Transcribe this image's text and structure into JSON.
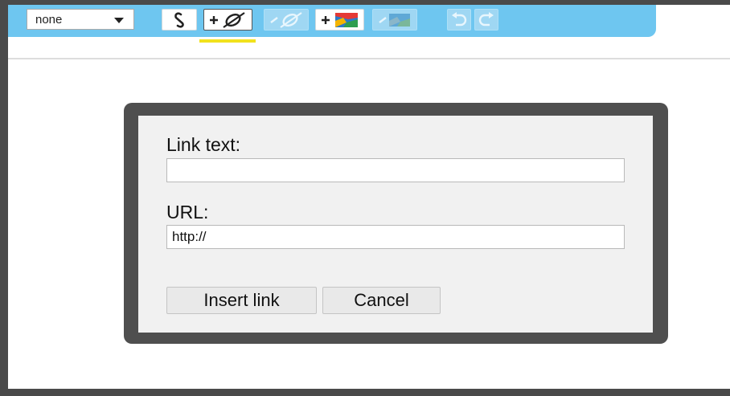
{
  "toolbar": {
    "style_select": {
      "value": "none"
    },
    "buttons": [
      {
        "icon": "link-icon",
        "enabled": true
      },
      {
        "icon": "add-link-icon",
        "enabled": true,
        "active": true
      },
      {
        "icon": "remove-link-icon",
        "enabled": false
      },
      {
        "icon": "add-image-icon",
        "enabled": true
      },
      {
        "icon": "remove-image-icon",
        "enabled": false
      },
      {
        "icon": "undo-icon",
        "enabled": false
      },
      {
        "icon": "redo-icon",
        "enabled": false
      }
    ],
    "colors": {
      "bar": "#6ec6f0",
      "active_underline": "#f2e21d"
    }
  },
  "dialog": {
    "link_text": {
      "label": "Link text:",
      "value": ""
    },
    "url": {
      "label": "URL:",
      "value": "http://"
    },
    "insert_label": "Insert link",
    "cancel_label": "Cancel"
  }
}
